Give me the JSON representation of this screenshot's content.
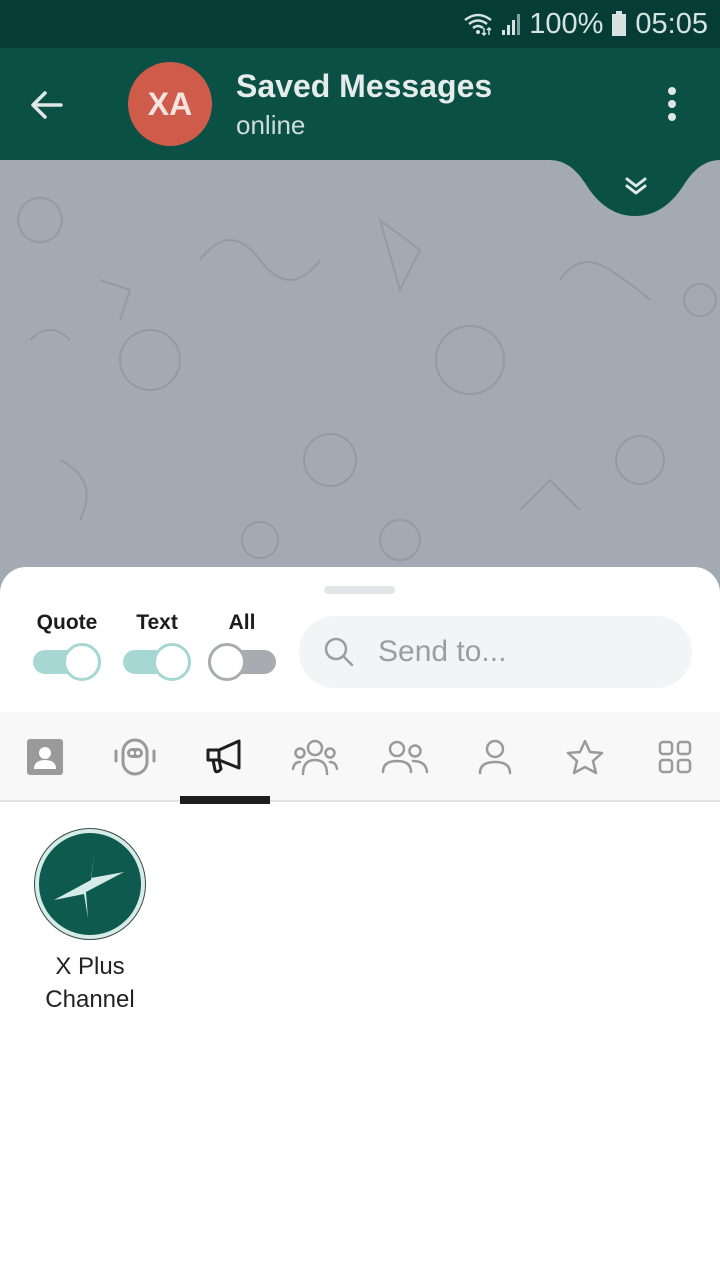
{
  "status_bar": {
    "battery": "100%",
    "time": "05:05",
    "icons": [
      "wifi-icon",
      "signal-icon",
      "battery-icon"
    ]
  },
  "header": {
    "avatar_initials": "XA",
    "avatar_color": "#cf5c4b",
    "title": "Saved Messages",
    "subtitle": "online",
    "back_icon": "arrow-left-icon",
    "menu_icon": "more-vertical-icon",
    "scroll_down_icon": "double-chevron-down-icon"
  },
  "theme": {
    "primary": "#0a5045",
    "status_bar": "#053d36",
    "toggle_on": "#a7d7d3",
    "toggle_off": "#a8abb0"
  },
  "share_sheet": {
    "toggles": [
      {
        "label": "Quote",
        "on": true
      },
      {
        "label": "Text",
        "on": true
      },
      {
        "label": "All",
        "on": false
      }
    ],
    "search": {
      "placeholder": "Send to...",
      "value": ""
    },
    "tabs": [
      {
        "id": "contacts",
        "icon": "contact-card-icon",
        "selected": false
      },
      {
        "id": "bots",
        "icon": "bot-icon",
        "selected": false
      },
      {
        "id": "channels",
        "icon": "megaphone-icon",
        "selected": true
      },
      {
        "id": "groups",
        "icon": "group-icon",
        "selected": false
      },
      {
        "id": "supergroups",
        "icon": "two-users-icon",
        "selected": false
      },
      {
        "id": "users",
        "icon": "user-icon",
        "selected": false
      },
      {
        "id": "favorites",
        "icon": "star-icon",
        "selected": false
      },
      {
        "id": "all",
        "icon": "grid-icon",
        "selected": false
      }
    ],
    "results": [
      {
        "name": "X Plus Channel",
        "name_line1": "X Plus",
        "name_line2": "Channel",
        "avatar_icon": "lightning-logo-icon"
      }
    ]
  }
}
